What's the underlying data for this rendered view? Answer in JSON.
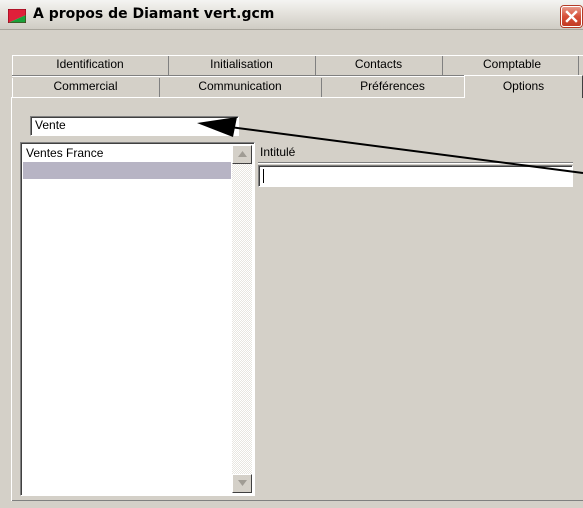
{
  "window": {
    "title": "A propos de Diamant vert.gcm",
    "icon": "app-red-green-icon",
    "close_icon": "close-icon"
  },
  "tabs": {
    "row1": [
      "Identification",
      "Initialisation",
      "Contacts",
      "Comptable"
    ],
    "row2": [
      "Commercial",
      "Communication",
      "Préférences",
      "Options"
    ],
    "active": "Options"
  },
  "options": {
    "combo_value": "Vente",
    "list_items": [
      "Ventes France",
      ""
    ],
    "selected_index": 1,
    "intitule_label": "Intitulé",
    "intitule_value": ""
  },
  "colors": {
    "face": "#d4d0c8",
    "selection": "#b7b4c4",
    "close_red": "#d6503a"
  }
}
